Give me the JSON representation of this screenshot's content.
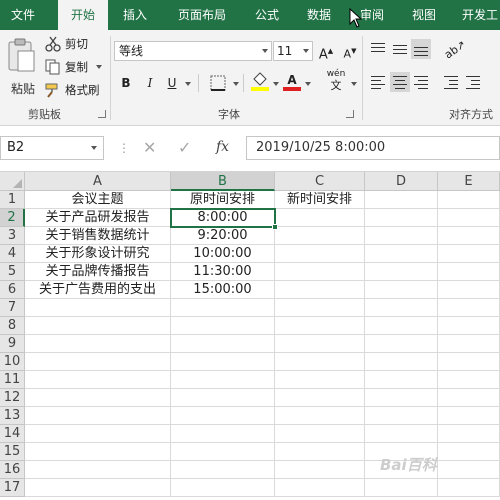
{
  "ribbon_tabs": [
    "文件",
    "开始",
    "插入",
    "页面布局",
    "公式",
    "数据",
    "审阅",
    "视图",
    "开发工"
  ],
  "active_tab": "开始",
  "clipboard": {
    "paste": "粘贴",
    "cut": "剪切",
    "copy": "复制",
    "format_painter": "格式刷",
    "group_label": "剪贴板"
  },
  "font_group": {
    "font_name": "等线",
    "font_size": "11",
    "bold": "B",
    "italic": "I",
    "underline": "U",
    "grow": "A",
    "shrink": "A",
    "phonetic": "wén",
    "font_color_letter": "A",
    "group_label": "字体"
  },
  "alignment_group": {
    "group_label": "对齐方式"
  },
  "formula_bar": {
    "name_box": "B2",
    "fx": "fx",
    "formula": "2019/10/25  8:00:00"
  },
  "columns": [
    "A",
    "B",
    "C",
    "D",
    "E"
  ],
  "selected_column": "B",
  "rows": [
    "1",
    "2",
    "3",
    "4",
    "5",
    "6",
    "7",
    "8",
    "9",
    "10",
    "11",
    "12",
    "13",
    "14",
    "15",
    "16",
    "17"
  ],
  "selected_row": "2",
  "cells": {
    "A1": "会议主题",
    "B1": "原时间安排",
    "C1": "新时间安排",
    "A2": "关于产品研发报告",
    "B2": "8:00:00",
    "A3": "关于销售数据统计",
    "B3": "9:20:00",
    "A4": "关于形象设计研究",
    "B4": "10:00:00",
    "A5": "关于品牌传播报告",
    "B5": "11:30:00",
    "A6": "关于广告费用的支出",
    "B6": "15:00:00"
  },
  "watermark": "Bai百科"
}
